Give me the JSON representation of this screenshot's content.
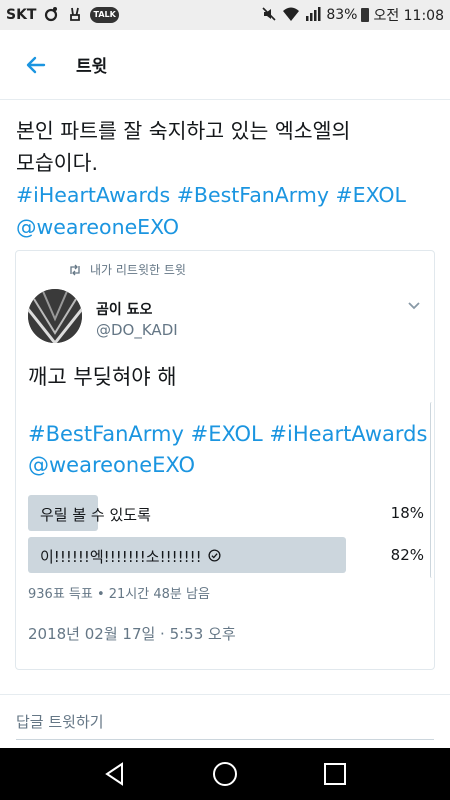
{
  "status_bar": {
    "carrier": "SKT",
    "talk_badge": "TALK",
    "battery": "83%",
    "time": "오전 11:08"
  },
  "app_bar": {
    "title": "트윗"
  },
  "tweet": {
    "text_line1": "본인 파트를 잘 숙지하고 있는 엑소엘의",
    "text_line2": "모습이다.",
    "hashtags": "#iHeartAwards #BestFanArmy #EXOL",
    "mention": "@weareoneEXO"
  },
  "quote": {
    "retweet_label": "내가 리트윗한 트윗",
    "author_name": "곰이 됴오",
    "author_handle": "@DO_KADI",
    "text": "깨고 부딪혀야 해",
    "hashtags": "#BestFanArmy #EXOL #iHeartAwards",
    "mention": "@weareoneEXO",
    "poll": {
      "options": [
        {
          "label": "우릴 볼 수 있도록",
          "percent": "18%",
          "fraction": 0.18,
          "winner": false
        },
        {
          "label": "이!!!!!!엑!!!!!!!소!!!!!!!",
          "percent": "82%",
          "fraction": 0.82,
          "winner": true
        }
      ],
      "meta": "936표 득표 • 21시간 48분 남음"
    },
    "date": "2018년 02월 17일 · 5:53 오후"
  },
  "reply": {
    "placeholder": "답글 트윗하기"
  },
  "colors": {
    "accent": "#1b95e0",
    "secondary_text": "#657786",
    "poll_bar": "#ccd6dd"
  }
}
